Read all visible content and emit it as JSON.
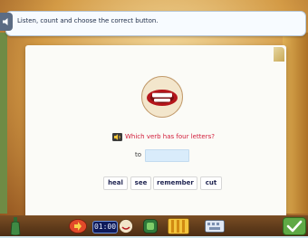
{
  "instruction": {
    "text": "Listen, count and choose the correct button.",
    "icon": "speaker-icon"
  },
  "question": {
    "text": "Which verb has four letters?",
    "icon": "speaker-icon",
    "prefix": "to",
    "answer_value": ""
  },
  "options": [
    {
      "label": "heal"
    },
    {
      "label": "see"
    },
    {
      "label": "remember"
    },
    {
      "label": "cut"
    }
  ],
  "toolbar": {
    "timer": "01:00",
    "icons": [
      "bottle-icon",
      "red-arrow-icon",
      "timer-display",
      "face-icon",
      "green-tile-icon",
      "dictionary-icon",
      "keyboard-icon",
      "check-icon"
    ]
  },
  "colors": {
    "question_text": "#d21d3b",
    "answer_box": "#d9ecfb",
    "button_text": "#1e2350"
  }
}
